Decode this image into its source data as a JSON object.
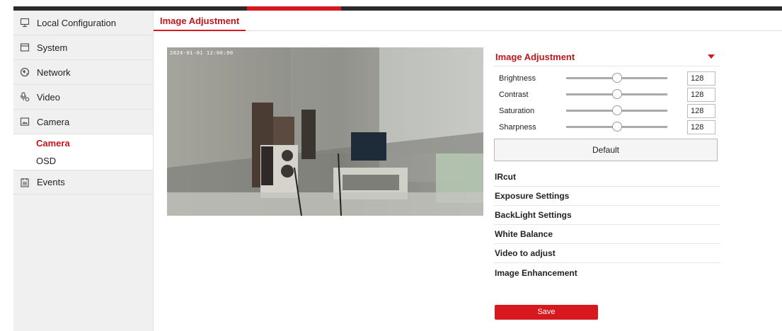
{
  "sidebar": {
    "items": [
      {
        "label": "Local Configuration",
        "icon": "monitor-icon"
      },
      {
        "label": "System",
        "icon": "system-icon"
      },
      {
        "label": "Network",
        "icon": "network-globe-icon"
      },
      {
        "label": "Video",
        "icon": "video-mic-icon"
      },
      {
        "label": "Camera",
        "icon": "camera-image-icon"
      }
    ],
    "camera_sub": {
      "camera": "Camera",
      "osd": "OSD"
    },
    "events": {
      "label": "Events",
      "icon": "events-calendar-icon"
    }
  },
  "tab": {
    "label": "Image Adjustment"
  },
  "video": {
    "timestamp": "2024-01-01 12:00:00"
  },
  "panel": {
    "title": "Image Adjustment",
    "sliders": [
      {
        "label": "Brightness",
        "value": "128",
        "fraction": 0.5
      },
      {
        "label": "Contrast",
        "value": "128",
        "fraction": 0.5
      },
      {
        "label": "Saturation",
        "value": "128",
        "fraction": 0.5
      },
      {
        "label": "Sharpness",
        "value": "128",
        "fraction": 0.5
      }
    ],
    "default_label": "Default",
    "sections": [
      "IRcut",
      "Exposure Settings",
      "BackLight Settings",
      "White Balance",
      "Video to adjust",
      "Image Enhancement"
    ],
    "save_label": "Save"
  },
  "colors": {
    "accent": "#d7181f",
    "sidebar_bg": "#f0f0f0",
    "topbar": "#2b2b2b"
  }
}
